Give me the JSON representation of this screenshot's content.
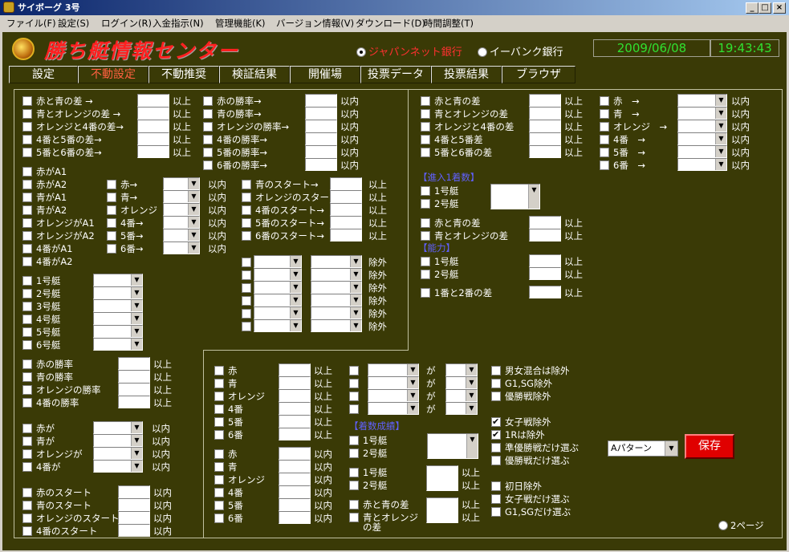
{
  "window": {
    "title": "サイボーグ 3号",
    "min": "_",
    "max": "□",
    "close": "×"
  },
  "menu": [
    "ファイル(F)",
    "設定(S)",
    "ログイン(R)",
    "入金指示(N)",
    "管理機能(K)",
    "バージョン情報(V)",
    "ダウンロード(D)",
    "時間調整(T)"
  ],
  "header": {
    "logo": "勝ち艇情報センター",
    "bank1": "ジャパンネット銀行",
    "bank2": "イーバンク銀行",
    "date": "2009/06/08",
    "time": "19:43:43"
  },
  "tabs": [
    "設定",
    "不動設定",
    "不動推奨",
    "検証結果",
    "開催場",
    "投票データ",
    "投票結果",
    "ブラウザ"
  ],
  "labels": {
    "diff": [
      "赤と青の差 →",
      "青とオレンジの差 →",
      "オレンジと4番の差→",
      "4番と5番の差→",
      "5番と6番の差→"
    ],
    "winrate": [
      "赤の勝率→",
      "青の勝率→",
      "オレンジの勝率→",
      "4番の勝率→",
      "5番の勝率→",
      "6番の勝率→"
    ],
    "grade": [
      "赤がA1",
      "赤がA2",
      "青がA1",
      "青がA2",
      "オレンジがA1",
      "オレンジがA2",
      "4番がA1",
      "4番がA2"
    ],
    "colors6": [
      "赤→",
      "青→",
      "オレンジ",
      "4番→",
      "5番→",
      "6番→"
    ],
    "start6": [
      "青のスタート→",
      "オレンジのスタート→",
      "4番のスタート→",
      "5番のスタート→",
      "6番のスタート→"
    ],
    "boats6": [
      "1号艇",
      "2号艇",
      "3号艇",
      "4号艇",
      "5号艇",
      "6号艇"
    ],
    "winrate4": [
      "赤の勝率",
      "青の勝率",
      "オレンジの勝率",
      "4番の勝率"
    ],
    "ga4": [
      "赤が",
      "青が",
      "オレンジが",
      "4番が"
    ],
    "start4": [
      "赤のスタート",
      "青のスタート",
      "オレンジのスタート",
      "4番のスタート"
    ],
    "diff2": [
      "赤と青の差",
      "青とオレンジの差",
      "オレンジと4番の差",
      "4番と5番差",
      "5番と6番の差"
    ],
    "colorsR": [
      "赤　→",
      "青　→",
      "オレンジ　→",
      "4番　→",
      "5番　→",
      "6番　→"
    ],
    "boats2": [
      "1号艇",
      "2号艇"
    ],
    "diffRB": [
      "赤と青の差",
      "青とオレンジの差"
    ],
    "oneTwo": "1番と2番の差",
    "colorsC": [
      "赤",
      "青",
      "オレンジ",
      "4番",
      "5番",
      "6番"
    ],
    "ga": "が",
    "opts1": [
      "男女混合は除外",
      "G1,SG除外",
      "優勝戦除外"
    ],
    "opts2": [
      "女子戦除外",
      "1Rは除外",
      "準優勝戦だけ選ぶ",
      "優勝戦だけ選ぶ"
    ],
    "opts3": [
      "初日除外",
      "女子戦だけ選ぶ",
      "G1,SGだけ選ぶ"
    ],
    "diffRB2a": "赤と青の差",
    "diffRB2b": "青とオレンジ",
    "diffRB2c": "の差"
  },
  "units": {
    "ijo": "以上",
    "inai": "以内",
    "jogai": "除外"
  },
  "sections": {
    "shinnyu": "【進入1着数】",
    "noryoku": "【能力】",
    "chakusu": "【着数成績】"
  },
  "pattern": "Aパターン",
  "save": "保存",
  "page2": "2ページ",
  "checked": [
    "女子戦除外",
    "1Rは除外"
  ]
}
